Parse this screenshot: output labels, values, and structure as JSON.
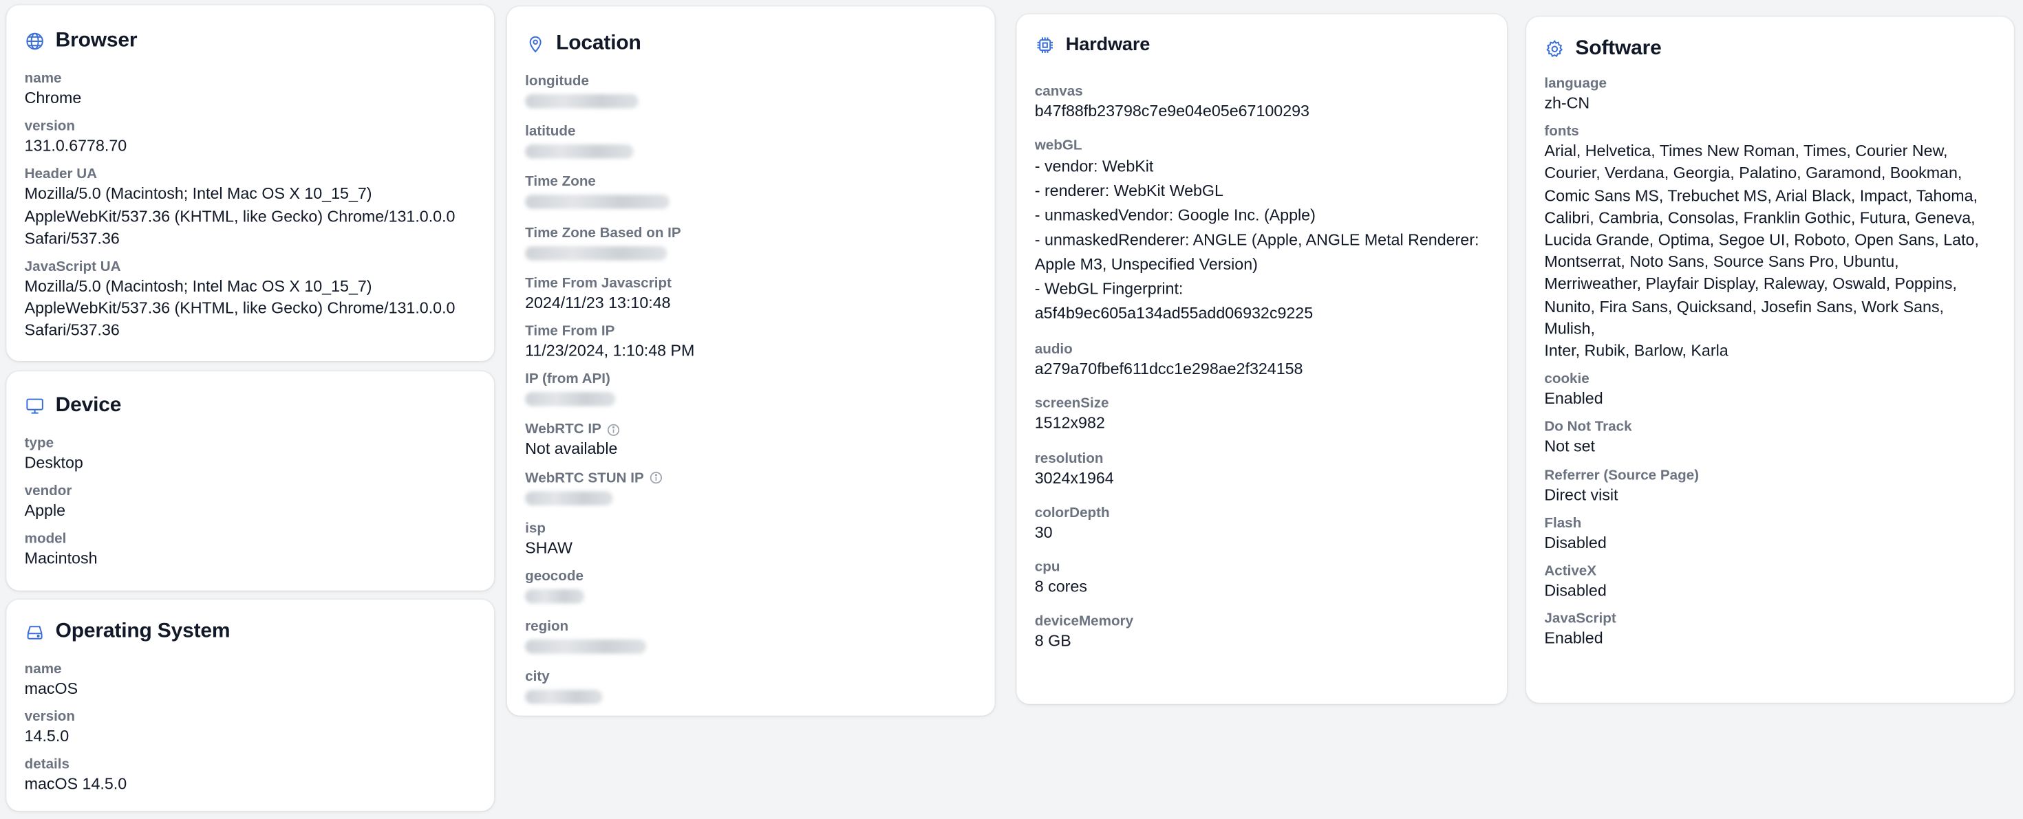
{
  "browser": {
    "title": "Browser",
    "icon": "globe-icon",
    "fields": [
      {
        "label": "name",
        "value": "Chrome"
      },
      {
        "label": "version",
        "value": "131.0.6778.70"
      },
      {
        "label": "Header UA",
        "value": "Mozilla/5.0 (Macintosh; Intel Mac OS X 10_15_7)\nAppleWebKit/537.36 (KHTML, like Gecko) Chrome/131.0.0.0\nSafari/537.36"
      },
      {
        "label": "JavaScript UA",
        "value": "Mozilla/5.0 (Macintosh; Intel Mac OS X 10_15_7)\nAppleWebKit/537.36 (KHTML, like Gecko) Chrome/131.0.0.0\nSafari/537.36"
      }
    ]
  },
  "device": {
    "title": "Device",
    "icon": "monitor-icon",
    "fields": [
      {
        "label": "type",
        "value": "Desktop"
      },
      {
        "label": "vendor",
        "value": "Apple"
      },
      {
        "label": "model",
        "value": "Macintosh"
      }
    ]
  },
  "os": {
    "title": "Operating System",
    "icon": "hard-drive-icon",
    "fields": [
      {
        "label": "name",
        "value": "macOS"
      },
      {
        "label": "version",
        "value": "14.5.0"
      },
      {
        "label": "details",
        "value": "macOS 14.5.0"
      }
    ]
  },
  "location": {
    "title": "Location",
    "icon": "map-pin-icon",
    "fields": [
      {
        "label": "longitude"
      },
      {
        "label": "latitude"
      },
      {
        "label": "Time Zone"
      },
      {
        "label": "Time Zone Based on IP"
      },
      {
        "label": "Time From Javascript",
        "value": "2024/11/23 13:10:48"
      },
      {
        "label": "Time From IP",
        "value": "11/23/2024, 1:10:48 PM"
      },
      {
        "label": "IP (from API)"
      },
      {
        "label": "WebRTC IP",
        "value": "Not available"
      },
      {
        "label": "WebRTC STUN IP"
      },
      {
        "label": "isp",
        "value": "SHAW"
      },
      {
        "label": "geocode"
      },
      {
        "label": "region"
      },
      {
        "label": "city"
      }
    ]
  },
  "hardware": {
    "title": "Hardware",
    "icon": "cpu-chip-icon",
    "fields": [
      {
        "label": "canvas",
        "value": "b47f88fb23798c7e9e04e05e67100293"
      },
      {
        "label": "webGL",
        "value": "- vendor: WebKit\n- renderer: WebKit WebGL\n- unmaskedVendor: Google Inc. (Apple)\n- unmaskedRenderer: ANGLE (Apple, ANGLE Metal Renderer:\nApple M3, Unspecified Version)\n- WebGL Fingerprint:\na5f4b9ec605a134ad55add06932c9225"
      },
      {
        "label": "audio",
        "value": "a279a70fbef611dcc1e298ae2f324158"
      },
      {
        "label": "screenSize",
        "value": "1512x982"
      },
      {
        "label": "resolution",
        "value": "3024x1964"
      },
      {
        "label": "colorDepth",
        "value": "30"
      },
      {
        "label": "cpu",
        "value": "8 cores"
      },
      {
        "label": "deviceMemory",
        "value": "8 GB"
      }
    ]
  },
  "software": {
    "title": "Software",
    "icon": "gear-icon",
    "fields": [
      {
        "label": "language",
        "value": "zh-CN"
      },
      {
        "label": "fonts",
        "value": "Arial, Helvetica, Times New Roman, Times, Courier New,\nCourier, Verdana, Georgia, Palatino, Garamond, Bookman,\nComic Sans MS, Trebuchet MS, Arial Black, Impact, Tahoma,\nCalibri, Cambria, Consolas, Franklin Gothic, Futura, Geneva,\nLucida Grande, Optima, Segoe UI, Roboto, Open Sans, Lato,\nMontserrat, Noto Sans, Source Sans Pro, Ubuntu,\nMerriweather, Playfair Display, Raleway, Oswald, Poppins,\nNunito, Fira Sans, Quicksand, Josefin Sans, Work Sans, Mulish,\nInter, Rubik, Barlow, Karla"
      },
      {
        "label": "cookie",
        "value": "Enabled"
      },
      {
        "label": "Do Not Track",
        "value": "Not set"
      },
      {
        "label": "Referrer (Source Page)",
        "value": "Direct visit"
      },
      {
        "label": "Flash",
        "value": "Disabled"
      },
      {
        "label": "ActiveX",
        "value": "Disabled"
      },
      {
        "label": "JavaScript",
        "value": "Enabled"
      }
    ]
  },
  "colors": {
    "accent": "#3b6fd8",
    "label": "#6b7280",
    "text": "#111827",
    "background": "#f3f4f6"
  }
}
